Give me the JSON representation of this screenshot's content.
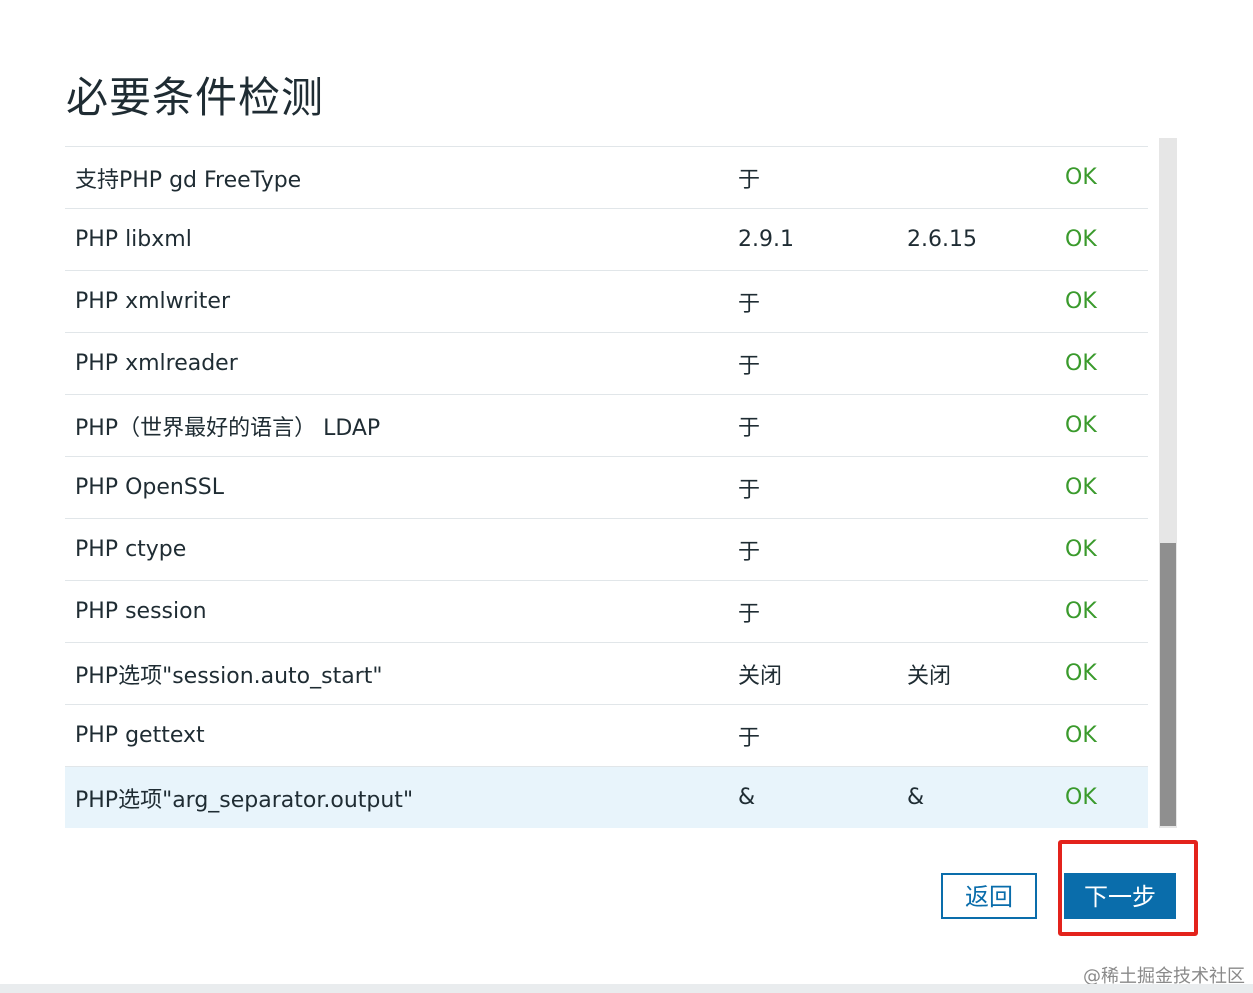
{
  "page": {
    "title": "必要条件检测"
  },
  "requirements": [
    {
      "name": "支持PHP gd FreeType",
      "current": "于",
      "required": "",
      "result": "OK"
    },
    {
      "name": "PHP libxml",
      "current": "2.9.1",
      "required": "2.6.15",
      "result": "OK"
    },
    {
      "name": "PHP xmlwriter",
      "current": "于",
      "required": "",
      "result": "OK"
    },
    {
      "name": "PHP xmlreader",
      "current": "于",
      "required": "",
      "result": "OK"
    },
    {
      "name": "PHP（世界最好的语言） LDAP",
      "current": "于",
      "required": "",
      "result": "OK"
    },
    {
      "name": "PHP OpenSSL",
      "current": "于",
      "required": "",
      "result": "OK"
    },
    {
      "name": "PHP ctype",
      "current": "于",
      "required": "",
      "result": "OK"
    },
    {
      "name": "PHP session",
      "current": "于",
      "required": "",
      "result": "OK"
    },
    {
      "name": "PHP选项\"session.auto_start\"",
      "current": "关闭",
      "required": "关闭",
      "result": "OK"
    },
    {
      "name": "PHP gettext",
      "current": "于",
      "required": "",
      "result": "OK"
    },
    {
      "name": "PHP选项\"arg_separator.output\"",
      "current": "&",
      "required": "&",
      "result": "OK"
    }
  ],
  "buttons": {
    "back": "返回",
    "next": "下一步"
  },
  "watermark": "@稀土掘金技术社区",
  "colors": {
    "ok": "#3a9a2c",
    "primary": "#0a6dab",
    "highlight_row": "#e8f4fb",
    "annotation_frame": "#e3231c"
  }
}
